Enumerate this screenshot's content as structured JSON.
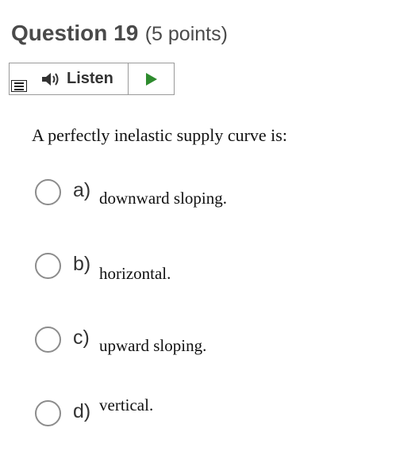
{
  "question": {
    "title": "Question 19",
    "points": "(5 points)"
  },
  "toolbar": {
    "menu_icon": "menu-icon",
    "speaker_icon": "speaker-icon",
    "listen_label": "Listen",
    "play_icon": "play-icon",
    "accent_color": "#2e8b2e"
  },
  "prompt": "A perfectly inelastic supply curve is:",
  "options": [
    {
      "letter": "a)",
      "text": "downward sloping.",
      "selected": false
    },
    {
      "letter": "b)",
      "text": "horizontal.",
      "selected": false
    },
    {
      "letter": "c)",
      "text": "upward sloping.",
      "selected": false
    },
    {
      "letter": "d)",
      "text": "vertical.",
      "selected": false
    }
  ]
}
